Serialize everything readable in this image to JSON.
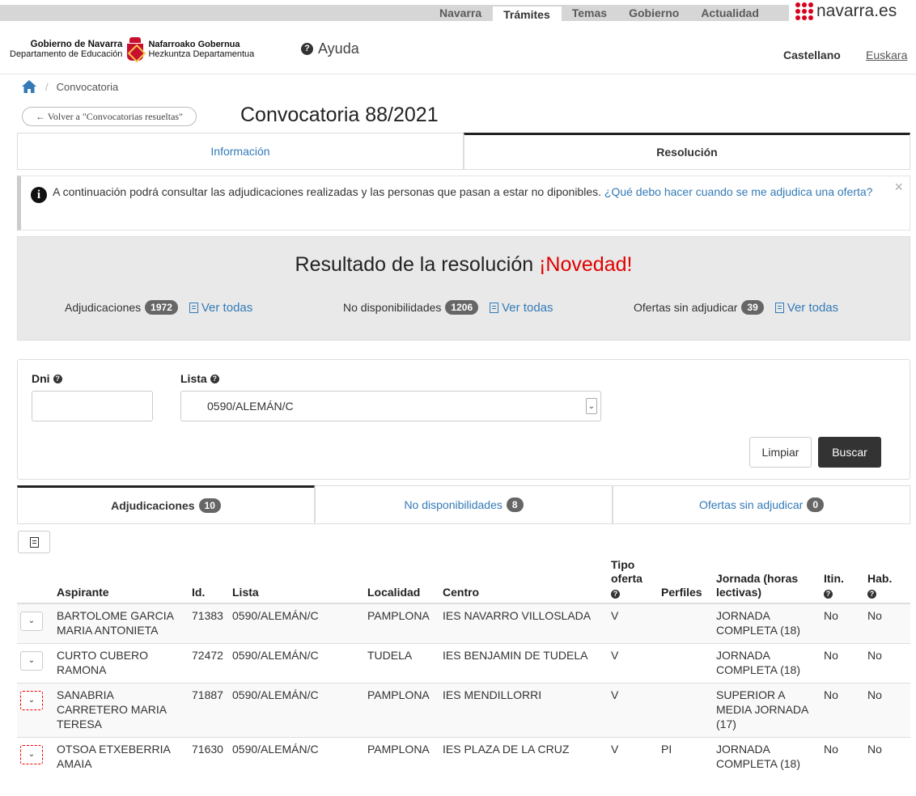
{
  "topnav": {
    "items": [
      {
        "label": "Navarra",
        "active": false
      },
      {
        "label": "Trámites",
        "active": true
      },
      {
        "label": "Temas",
        "active": false
      },
      {
        "label": "Gobierno",
        "active": false
      },
      {
        "label": "Actualidad",
        "active": false
      }
    ],
    "brand": "navarra.es"
  },
  "header": {
    "logo_left_line1": "Gobierno de Navarra",
    "logo_left_line2": "Departamento de Educación",
    "logo_right_line1": "Nafarroako Gobernua",
    "logo_right_line2": "Hezkuntza Departamentua",
    "help": "Ayuda",
    "lang_active": "Castellano",
    "lang_other": "Euskara"
  },
  "breadcrumb": {
    "current": "Convocatoria"
  },
  "back_button": "← Volver a \"Convocatorias resueltas\"",
  "page_title": "Convocatoria 88/2021",
  "main_tabs": [
    {
      "label": "Información",
      "active": false
    },
    {
      "label": "Resolución",
      "active": true
    }
  ],
  "alert": {
    "text": "A continuación podrá consultar las adjudicaciones realizadas y las personas que pasan a estar no diponibles.",
    "link": "¿Qué debo hacer cuando se me adjudica una oferta?",
    "close": "×"
  },
  "result": {
    "title": "Resultado de la resolución",
    "highlight": "¡Novedad!",
    "stats": [
      {
        "label": "Adjudicaciones",
        "count": "1972",
        "link": "Ver todas"
      },
      {
        "label": "No disponibilidades",
        "count": "1206",
        "link": "Ver todas"
      },
      {
        "label": "Ofertas sin adjudicar",
        "count": "39",
        "link": "Ver todas"
      }
    ]
  },
  "filter": {
    "dni_label": "Dni",
    "dni_value": "",
    "lista_label": "Lista",
    "lista_value": "0590/ALEMÁN/C",
    "clear_button": "Limpiar",
    "search_button": "Buscar"
  },
  "result_tabs": [
    {
      "label": "Adjudicaciones",
      "count": "10",
      "active": true
    },
    {
      "label": "No disponibilidades",
      "count": "8",
      "active": false
    },
    {
      "label": "Ofertas sin adjudicar",
      "count": "0",
      "active": false
    }
  ],
  "table": {
    "headers": {
      "aspirante": "Aspirante",
      "id": "Id.",
      "lista": "Lista",
      "localidad": "Localidad",
      "centro": "Centro",
      "tipo_oferta_1": "Tipo",
      "tipo_oferta_2": "oferta",
      "perfiles": "Perfiles",
      "jornada": "Jornada (horas lectivas)",
      "itin": "Itin.",
      "hab": "Hab."
    },
    "rows": [
      {
        "aspirante": "BARTOLOME GARCIA MARIA ANTONIETA",
        "id": "71383",
        "lista": "0590/ALEMÁN/C",
        "localidad": "PAMPLONA",
        "centro": "IES NAVARRO VILLOSLADA",
        "tipo": "V",
        "perfiles": "",
        "jornada": "JORNADA COMPLETA (18)",
        "itin": "No",
        "hab": "No"
      },
      {
        "aspirante": "CURTO CUBERO RAMONA",
        "id": "72472",
        "lista": "0590/ALEMÁN/C",
        "localidad": "TUDELA",
        "centro": "IES BENJAMIN DE TUDELA",
        "tipo": "V",
        "perfiles": "",
        "jornada": "JORNADA COMPLETA (18)",
        "itin": "No",
        "hab": "No"
      },
      {
        "aspirante": "SANABRIA CARRETERO MARIA TERESA",
        "id": "71887",
        "lista": "0590/ALEMÁN/C",
        "localidad": "PAMPLONA",
        "centro": "IES MENDILLORRI",
        "tipo": "V",
        "perfiles": "",
        "jornada": "SUPERIOR A MEDIA JORNADA (17)",
        "itin": "No",
        "hab": "No"
      },
      {
        "aspirante": "OTSOA ETXEBERRIA AMAIA",
        "id": "71630",
        "lista": "0590/ALEMÁN/C",
        "localidad": "PAMPLONA",
        "centro": "IES PLAZA DE LA CRUZ",
        "tipo": "V",
        "perfiles": "PI",
        "jornada": "JORNADA COMPLETA (18)",
        "itin": "No",
        "hab": "No"
      }
    ]
  }
}
